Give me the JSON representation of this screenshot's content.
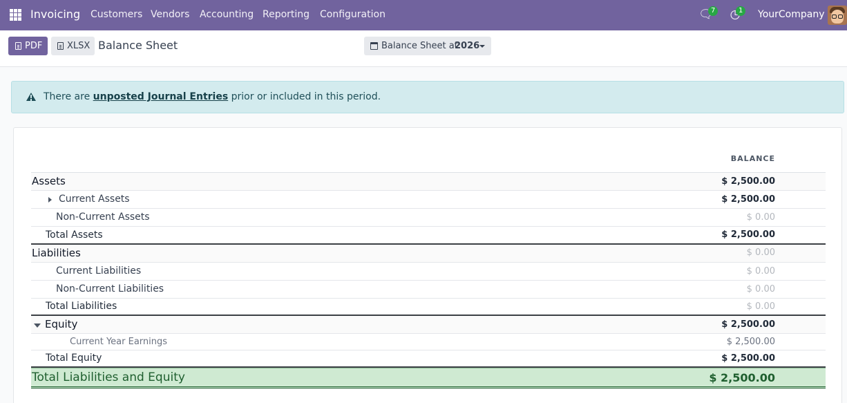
{
  "navbar": {
    "app_name": "Invoicing",
    "menu": [
      "Customers",
      "Vendors",
      "Accounting",
      "Reporting",
      "Configuration"
    ],
    "messages_count": "7",
    "activities_count": "1",
    "company": "YourCompany",
    "icons": [
      "apps-grid-icon",
      "chat-icon",
      "clock-icon",
      "avatar"
    ],
    "color": "#71639e"
  },
  "toolbar": {
    "pdf_label": "PDF",
    "xlsx_label": "XLSX",
    "title": "Balance Sheet",
    "date_filter_prefix": "Balance Sheet at:",
    "date_filter_value": "2026"
  },
  "alert": {
    "prefix": "There are",
    "link": "unposted Journal Entries",
    "suffix": "prior or included in this period."
  },
  "report": {
    "column_header": "BALANCE",
    "rows": [
      {
        "name": "Assets",
        "amount": "$ 2,500.00"
      },
      {
        "name": "Current Assets",
        "amount": "$ 2,500.00"
      },
      {
        "name": "Non-Current Assets",
        "amount": "$ 0.00"
      },
      {
        "name": "Total Assets",
        "amount": "$ 2,500.00"
      },
      {
        "name": "Liabilities",
        "amount": "$ 0.00"
      },
      {
        "name": "Current Liabilities",
        "amount": "$ 0.00"
      },
      {
        "name": "Non-Current Liabilities",
        "amount": "$ 0.00"
      },
      {
        "name": "Total Liabilities",
        "amount": "$ 0.00"
      },
      {
        "name": "Equity",
        "amount": "$ 2,500.00"
      },
      {
        "name": "Current Year Earnings",
        "amount": "$ 2,500.00"
      },
      {
        "name": "Total Equity",
        "amount": "$ 2,500.00"
      },
      {
        "name": "Total Liabilities and Equity",
        "amount": "$ 2,500.00"
      }
    ]
  }
}
